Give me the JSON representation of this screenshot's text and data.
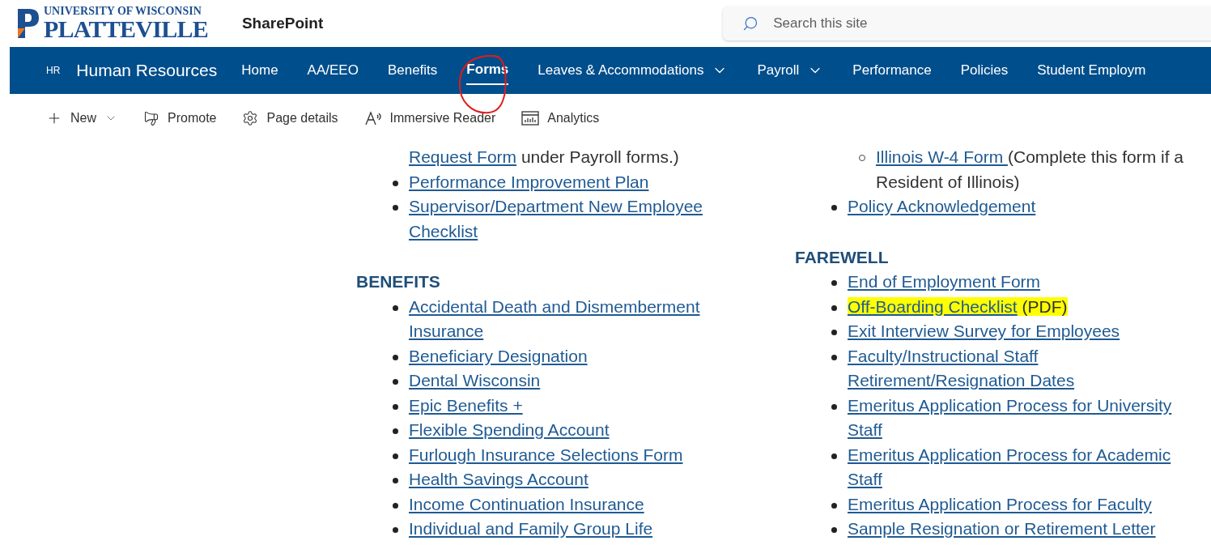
{
  "header": {
    "logo": {
      "line_1": "UNIVERSITY OF WISCONSIN",
      "line_2": "PLATTEVILLE"
    },
    "app_name": "SharePoint",
    "search": {
      "placeholder": "Search this site"
    }
  },
  "site_nav": {
    "badge": "HR",
    "site_title": "Human Resources",
    "items": [
      {
        "label": "Home",
        "selected": false,
        "dropdown": false,
        "circled": false
      },
      {
        "label": "AA/EEO",
        "selected": false,
        "dropdown": false,
        "circled": false
      },
      {
        "label": "Benefits",
        "selected": false,
        "dropdown": false,
        "circled": false
      },
      {
        "label": "Forms",
        "selected": true,
        "dropdown": false,
        "circled": true
      },
      {
        "label": "Leaves & Accommodations",
        "selected": false,
        "dropdown": true,
        "circled": false
      },
      {
        "label": "Payroll",
        "selected": false,
        "dropdown": true,
        "circled": false
      },
      {
        "label": "Performance",
        "selected": false,
        "dropdown": false,
        "circled": false
      },
      {
        "label": "Policies",
        "selected": false,
        "dropdown": false,
        "circled": false
      },
      {
        "label": "Student Employm",
        "selected": false,
        "dropdown": false,
        "circled": false
      }
    ]
  },
  "command_bar": [
    {
      "kind": "new",
      "label": "New"
    },
    {
      "kind": "promote",
      "label": "Promote"
    },
    {
      "kind": "details",
      "label": "Page details"
    },
    {
      "kind": "reader",
      "label": "Immersive Reader"
    },
    {
      "kind": "analytics",
      "label": "Analytics"
    }
  ],
  "columns": [
    [
      {
        "kind": "continuation",
        "link": "Request Form",
        "suffix": " under Payroll forms.)",
        "highlighted": false
      },
      {
        "kind": "bullet",
        "link": "Performance Improvement Plan",
        "highlighted": false
      },
      {
        "kind": "bullet",
        "link": "Supervisor/Department New Employee Checklist",
        "highlighted": false
      },
      {
        "kind": "heading",
        "text": "BENEFITS"
      },
      {
        "kind": "bullet",
        "link": "Accidental Death and Dismemberment Insurance",
        "highlighted": false
      },
      {
        "kind": "bullet",
        "link": "Beneficiary Designation",
        "highlighted": false
      },
      {
        "kind": "bullet",
        "link": "Dental Wisconsin",
        "highlighted": false
      },
      {
        "kind": "bullet",
        "link": "Epic Benefits +",
        "highlighted": false
      },
      {
        "kind": "bullet",
        "link": "Flexible Spending Account",
        "highlighted": false
      },
      {
        "kind": "bullet",
        "link": "Furlough Insurance Selections Form",
        "highlighted": false
      },
      {
        "kind": "bullet",
        "link": "Health Savings Account",
        "highlighted": false
      },
      {
        "kind": "bullet",
        "link": "Income Continuation Insurance",
        "highlighted": false
      },
      {
        "kind": "bullet",
        "link": "Individual and Family Group Life",
        "highlighted": false
      }
    ],
    [
      {
        "kind": "sub-bullet",
        "link": "Illinois W-4 Form ",
        "suffix": "(Complete this form if a Resident of Illinois)",
        "highlighted": false
      },
      {
        "kind": "bullet",
        "link": "Policy Acknowledgement",
        "highlighted": false
      },
      {
        "kind": "heading",
        "text": "FAREWELL"
      },
      {
        "kind": "bullet",
        "link": "End of Employment Form",
        "highlighted": false
      },
      {
        "kind": "bullet",
        "link": "Off-Boarding Checklist",
        "suffix": " (PDF)",
        "highlighted": true
      },
      {
        "kind": "bullet",
        "link": "Exit Interview Survey for Employees",
        "highlighted": false
      },
      {
        "kind": "bullet",
        "link": "Faculty/Instructional Staff Retirement/Resignation Dates",
        "highlighted": false
      },
      {
        "kind": "bullet",
        "link": "Emeritus Application Process for University Staff",
        "highlighted": false
      },
      {
        "kind": "bullet",
        "link": "Emeritus Application Process for Academic Staff",
        "highlighted": false
      },
      {
        "kind": "bullet",
        "link": "Emeritus Application Process for Faculty",
        "highlighted": false
      },
      {
        "kind": "bullet",
        "link": "Sample Resignation or Retirement Letter",
        "highlighted": false
      }
    ]
  ]
}
